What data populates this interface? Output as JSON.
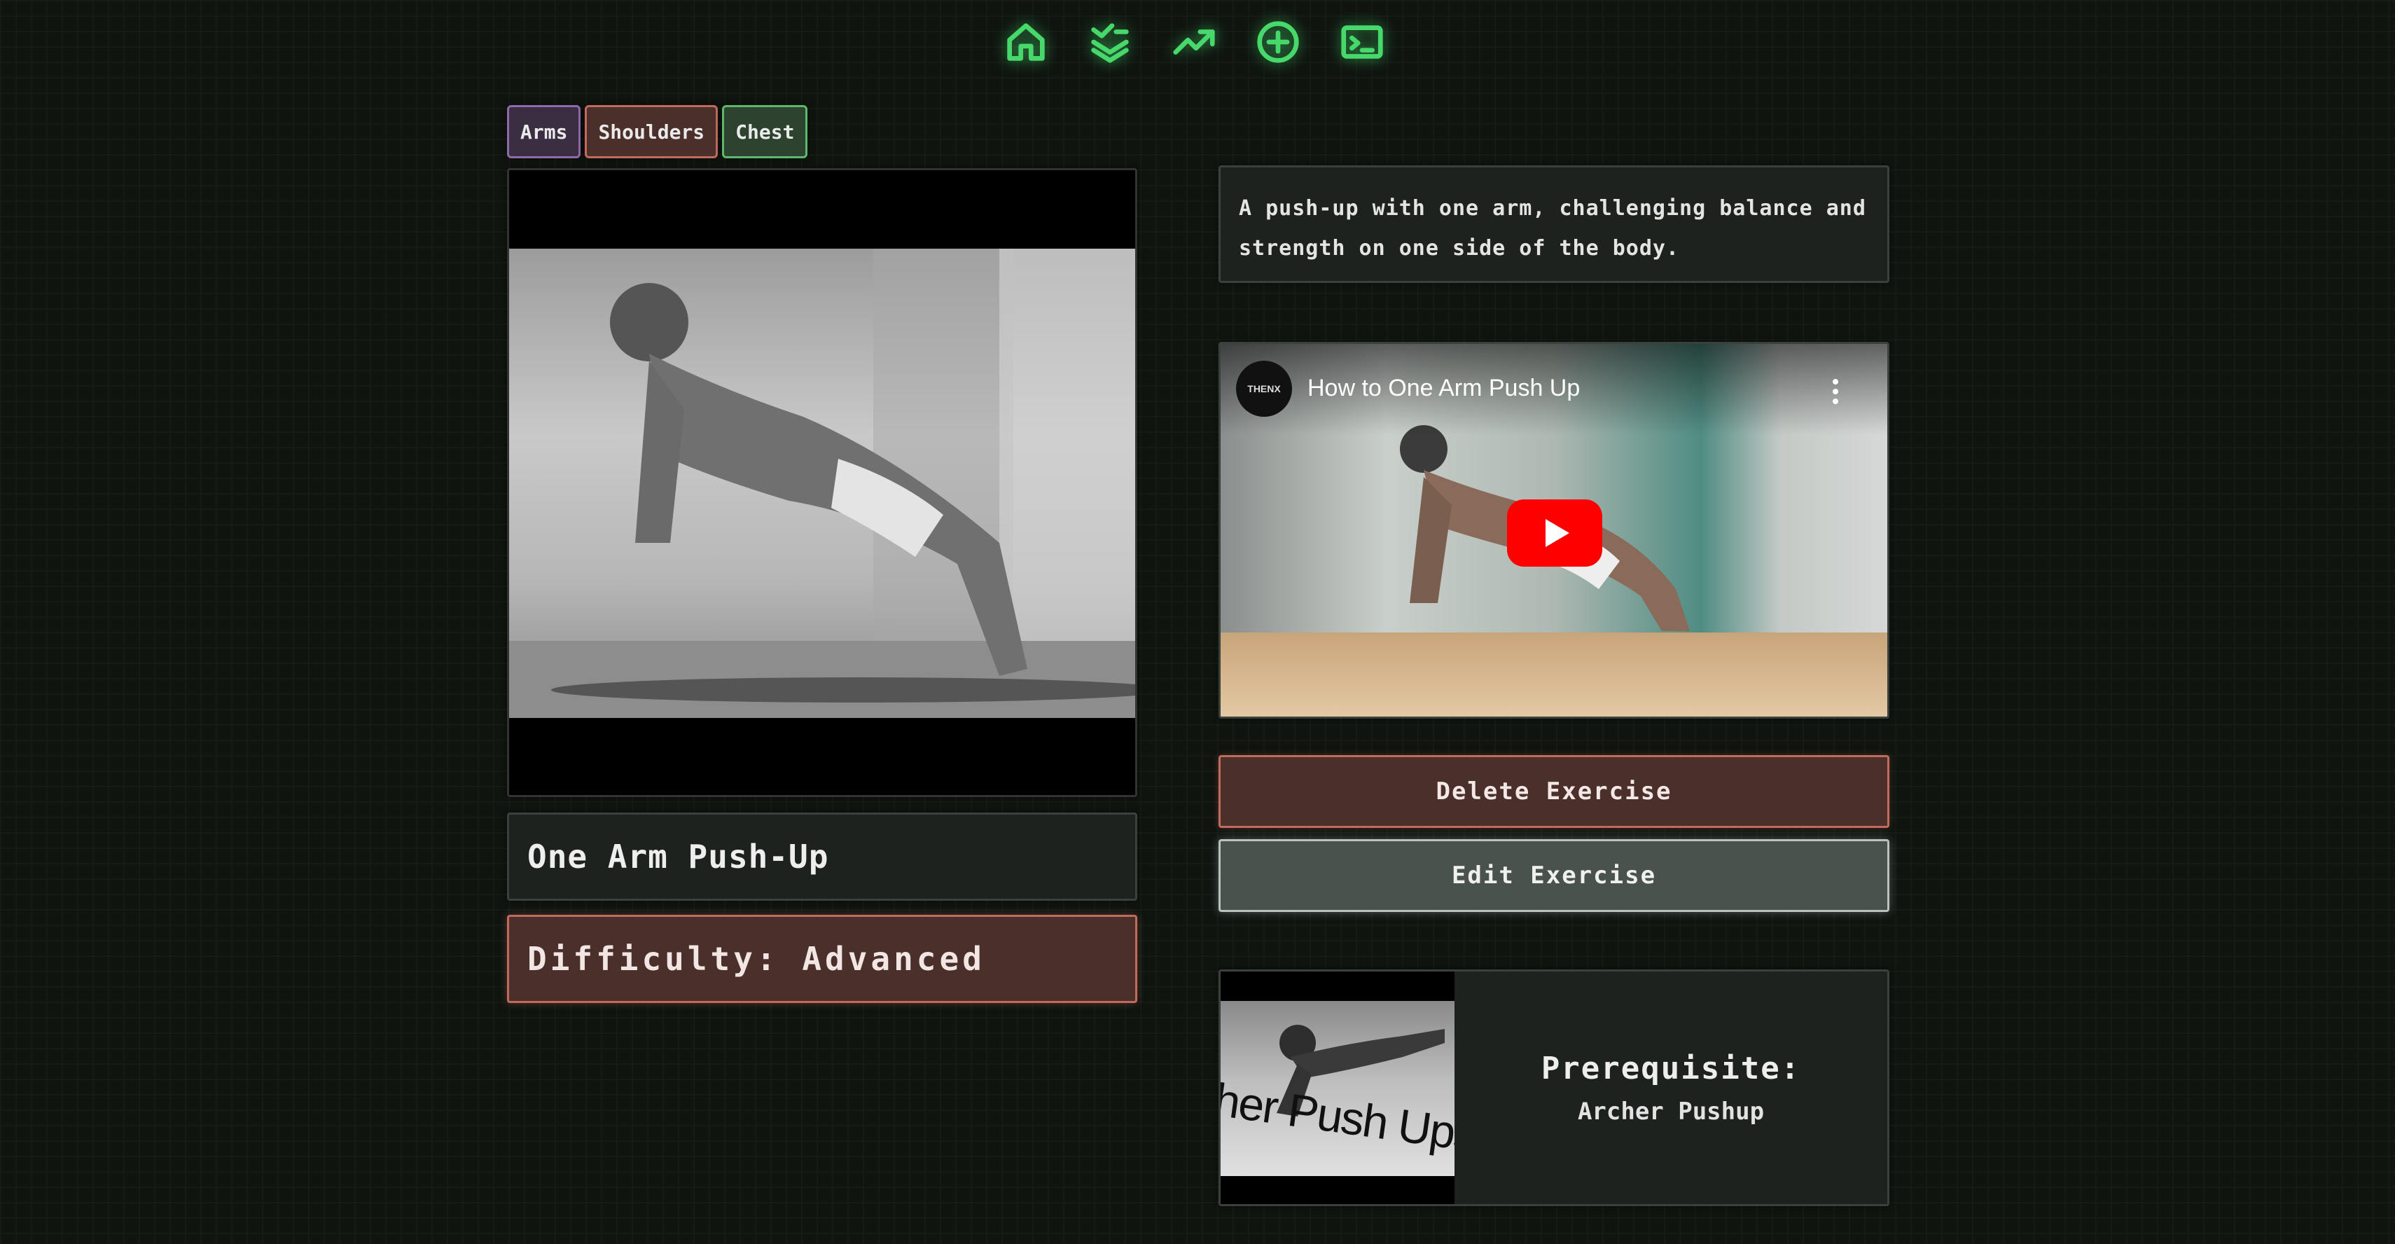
{
  "nav": {
    "items": [
      {
        "icon": "home-icon"
      },
      {
        "icon": "workout-list-icon"
      },
      {
        "icon": "trending-up-icon"
      },
      {
        "icon": "add-circle-icon"
      },
      {
        "icon": "terminal-icon"
      }
    ],
    "accent_color": "#47d86b"
  },
  "tags": [
    {
      "label": "Arms",
      "color": "#8e6aa8"
    },
    {
      "label": "Shoulders",
      "color": "#c26a5d"
    },
    {
      "label": "Chest",
      "color": "#5cb96c"
    }
  ],
  "exercise": {
    "name": "One Arm Push-Up",
    "difficulty": "Difficulty: Advanced",
    "description_line1": "A push-up with one arm, challenging balance and",
    "description_line2": "strength on one side of the body."
  },
  "video": {
    "title": "How to One Arm Push Up",
    "channel": "THENX"
  },
  "actions": {
    "delete_label": "Delete Exercise",
    "edit_label": "Edit Exercise"
  },
  "prerequisite": {
    "label": "Prerequisite:",
    "name": "Archer Pushup",
    "thumbnail_caption": "her Push Ups"
  }
}
